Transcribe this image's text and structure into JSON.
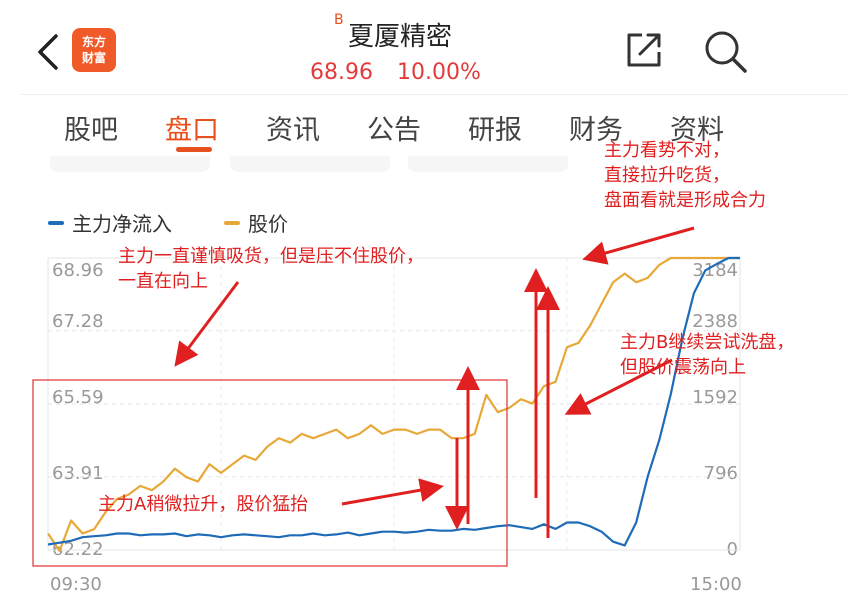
{
  "header": {
    "logo_line1": "东方",
    "logo_line2": "财富",
    "badge": "B",
    "stock_name": "夏厦精密",
    "price": "68.96",
    "change_pct": "10.00%"
  },
  "tabs": [
    {
      "label": "股吧"
    },
    {
      "label": "盘口"
    },
    {
      "label": "资讯"
    },
    {
      "label": "公告"
    },
    {
      "label": "研报"
    },
    {
      "label": "财务"
    },
    {
      "label": "资料"
    }
  ],
  "active_tab": 1,
  "legend": {
    "flow_label": "主力净流入",
    "price_label": "股价"
  },
  "colors": {
    "accent": "#e8501d",
    "price_up": "#e23b3b",
    "price_line": "#e8a838",
    "flow_line": "#1e6bb8",
    "annotation": "#e02020"
  },
  "annotations": {
    "n1_line1": "主力一直谨慎吸货，但是压不住股价，",
    "n1_line2": "一直在向上",
    "n2": "主力A稍微拉升，股价猛抬",
    "n3_line1": "主力看势不对，",
    "n3_line2": "直接拉升吃货，",
    "n3_line3": "盘面看就是形成合力",
    "n4_line1": "主力B继续尝试洗盘，",
    "n4_line2": "但股价震荡向上"
  },
  "chart_data": {
    "type": "line",
    "xlabel": "",
    "ylabel": "",
    "x_ticks": [
      "09:30",
      "15:00"
    ],
    "y_left_ticks": [
      "68.96",
      "67.28",
      "65.59",
      "63.91",
      "62.22"
    ],
    "y_right_ticks": [
      "3184",
      "2388",
      "1592",
      "796",
      "0"
    ],
    "y_left_range": [
      62.22,
      68.96
    ],
    "y_right_range": [
      0,
      3184
    ],
    "x": [
      0,
      4,
      8,
      12,
      16,
      20,
      24,
      28,
      32,
      36,
      40,
      44,
      48,
      52,
      56,
      60,
      64,
      68,
      72,
      76,
      80,
      84,
      88,
      92,
      96,
      100,
      104,
      108,
      112,
      116,
      120,
      124,
      128,
      132,
      136,
      140,
      144,
      148,
      152,
      156,
      160,
      164,
      168,
      172,
      176,
      180,
      184,
      188,
      192,
      196,
      200,
      204,
      208,
      212,
      216,
      220,
      224,
      228,
      232,
      236,
      240
    ],
    "series": [
      {
        "name": "股价",
        "axis": "left",
        "values": [
          62.6,
          62.2,
          62.9,
          62.6,
          62.7,
          63.1,
          63.4,
          63.5,
          63.7,
          63.6,
          63.8,
          64.1,
          63.9,
          63.8,
          64.2,
          64.0,
          64.2,
          64.4,
          64.3,
          64.6,
          64.8,
          64.7,
          64.9,
          64.8,
          64.9,
          65.0,
          64.8,
          64.9,
          65.1,
          64.9,
          65.0,
          65.0,
          64.9,
          65.0,
          65.0,
          64.8,
          64.8,
          64.9,
          65.8,
          65.4,
          65.5,
          65.7,
          65.6,
          66.0,
          66.1,
          66.9,
          67.0,
          67.4,
          67.9,
          68.4,
          68.6,
          68.4,
          68.5,
          68.8,
          68.96,
          68.96,
          68.96,
          68.96,
          68.96,
          68.96,
          68.96
        ]
      },
      {
        "name": "主力净流入",
        "axis": "right",
        "values": [
          60,
          80,
          100,
          140,
          150,
          160,
          180,
          180,
          160,
          170,
          170,
          180,
          150,
          170,
          160,
          140,
          160,
          170,
          160,
          150,
          140,
          160,
          160,
          180,
          160,
          170,
          190,
          160,
          180,
          200,
          200,
          190,
          200,
          220,
          210,
          210,
          230,
          220,
          240,
          260,
          270,
          250,
          230,
          280,
          230,
          300,
          300,
          260,
          200,
          90,
          50,
          300,
          800,
          1200,
          1700,
          2300,
          2800,
          3050,
          3120,
          3184,
          3184
        ]
      }
    ],
    "grid": true,
    "legend_position": "top-left"
  }
}
